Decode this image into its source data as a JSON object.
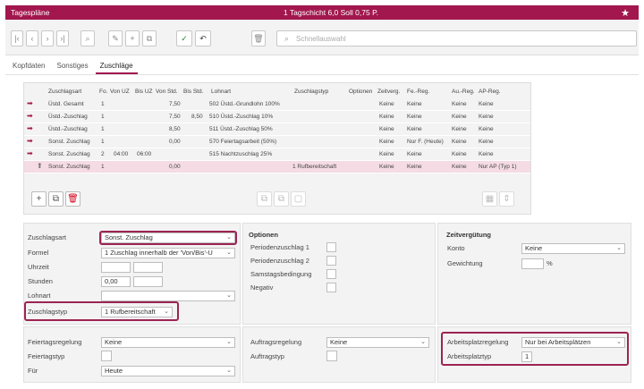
{
  "titlebar": {
    "title": "Tagespläne",
    "center": "1  Tagschicht 6,0 Soll 0,75 P.",
    "star": "★"
  },
  "toolbar": {
    "buttons": [
      "|‹",
      "‹",
      "›",
      "›|",
      "⌕",
      "✎",
      "+",
      "⧉",
      "✓",
      "↶",
      "🗑"
    ],
    "search_placeholder": "Schnellauswahl"
  },
  "tabs": [
    {
      "label": "Kopfdaten",
      "active": false
    },
    {
      "label": "Sonstiges",
      "active": false
    },
    {
      "label": "Zuschläge",
      "active": true
    }
  ],
  "table": {
    "headers": [
      "Zuschlagsart",
      "Fo.",
      "Von UZ",
      "Bis UZ",
      "Von Std.",
      "Bis Std.",
      "Lohnart",
      "Zuschlagstyp",
      "Optionen",
      "Zeitverg.",
      "Fe.-Reg.",
      "Au.-Reg.",
      "AP-Reg."
    ],
    "rows": [
      {
        "arrow": "➡",
        "art": "Üstd. Gesamt",
        "fo": "1",
        "vonuz": "",
        "bisuz": "",
        "vonstd": "7,50",
        "bisstd": "",
        "lohnart": "502 Üstd.-Grundlohn 100%",
        "typ": "",
        "opt": "",
        "zeit": "Keine",
        "fe": "Keine",
        "au": "Keine",
        "ap": "Keine",
        "sel": false
      },
      {
        "arrow": "➡",
        "art": "Üstd.-Zuschlag",
        "fo": "1",
        "vonuz": "",
        "bisuz": "",
        "vonstd": "7,50",
        "bisstd": "8,50",
        "lohnart": "510 Üstd.-Zuschlag 10%",
        "typ": "",
        "opt": "",
        "zeit": "Keine",
        "fe": "Keine",
        "au": "Keine",
        "ap": "Keine",
        "sel": false
      },
      {
        "arrow": "➡",
        "art": "Üstd.-Zuschlag",
        "fo": "1",
        "vonuz": "",
        "bisuz": "",
        "vonstd": "8,50",
        "bisstd": "",
        "lohnart": "511 Üstd.-Zuschlag 50%",
        "typ": "",
        "opt": "",
        "zeit": "Keine",
        "fe": "Keine",
        "au": "Keine",
        "ap": "Keine",
        "sel": false
      },
      {
        "arrow": "➡",
        "art": "Sonst. Zuschlag",
        "fo": "1",
        "vonuz": "",
        "bisuz": "",
        "vonstd": "0,00",
        "bisstd": "",
        "lohnart": "570 Feiertagsarbeit (50%)",
        "typ": "",
        "opt": "",
        "zeit": "Keine",
        "fe": "Nur F. (Heute)",
        "au": "Keine",
        "ap": "Keine",
        "sel": false
      },
      {
        "arrow": "➡",
        "art": "Sonst. Zuschlag",
        "fo": "2",
        "vonuz": "04:00",
        "bisuz": "06:00",
        "vonstd": "",
        "bisstd": "",
        "lohnart": "515 Nachtzuschlag 25%",
        "typ": "",
        "opt": "",
        "zeit": "Keine",
        "fe": "Keine",
        "au": "Keine",
        "ap": "Keine",
        "sel": false
      },
      {
        "arrow": "⬆",
        "art": "Sonst. Zuschlag",
        "fo": "1",
        "vonuz": "",
        "bisuz": "",
        "vonstd": "0,00",
        "bisstd": "",
        "lohnart": "",
        "typ": "1 Rufbereitschaft",
        "opt": "",
        "zeit": "Keine",
        "fe": "Keine",
        "au": "Keine",
        "ap": "Nur AP (Typ 1)",
        "sel": true
      }
    ]
  },
  "form": {
    "zuschlagsart": {
      "label": "Zuschlagsart",
      "value": "Sonst. Zuschlag"
    },
    "formel": {
      "label": "Formel",
      "value": "1 Zuschlag innerhalb der 'Von/Bis'-U"
    },
    "uhrzeit": {
      "label": "Uhrzeit"
    },
    "stunden": {
      "label": "Stunden",
      "value": "0,00"
    },
    "lohnart": {
      "label": "Lohnart",
      "value": ""
    },
    "zuschlagstyp": {
      "label": "Zuschlagstyp",
      "value": "1 Rufbereitschaft"
    },
    "optionen": {
      "title": "Optionen",
      "items": [
        "Periodenzuschlag 1",
        "Periodenzuschlag 2",
        "Samstagsbedingung",
        "Negativ"
      ]
    },
    "zeitverguetung": {
      "title": "Zeitvergütung",
      "konto_label": "Konto",
      "konto_value": "Keine",
      "gewichtung_label": "Gewichtung",
      "gewichtung_unit": "%"
    },
    "feiertagsregelung": {
      "label": "Feiertagsregelung",
      "value": "Keine"
    },
    "feiertagstyp": {
      "label": "Feiertagstyp"
    },
    "fuer": {
      "label": "Für",
      "value": "Heute"
    },
    "auftragsregelung": {
      "label": "Auftragsregelung",
      "value": "Keine"
    },
    "auftragstyp": {
      "label": "Auftragstyp"
    },
    "arbeitsplatzregelung": {
      "label": "Arbeitsplatzregelung",
      "value": "Nur bei Arbeitsplätzen"
    },
    "arbeitsplatztyp": {
      "label": "Arbeitsplatztyp",
      "value": "1"
    }
  },
  "colors": {
    "brand": "#a2174e",
    "selected_row": "#f5dbe4",
    "highlight": "#9c2452"
  }
}
